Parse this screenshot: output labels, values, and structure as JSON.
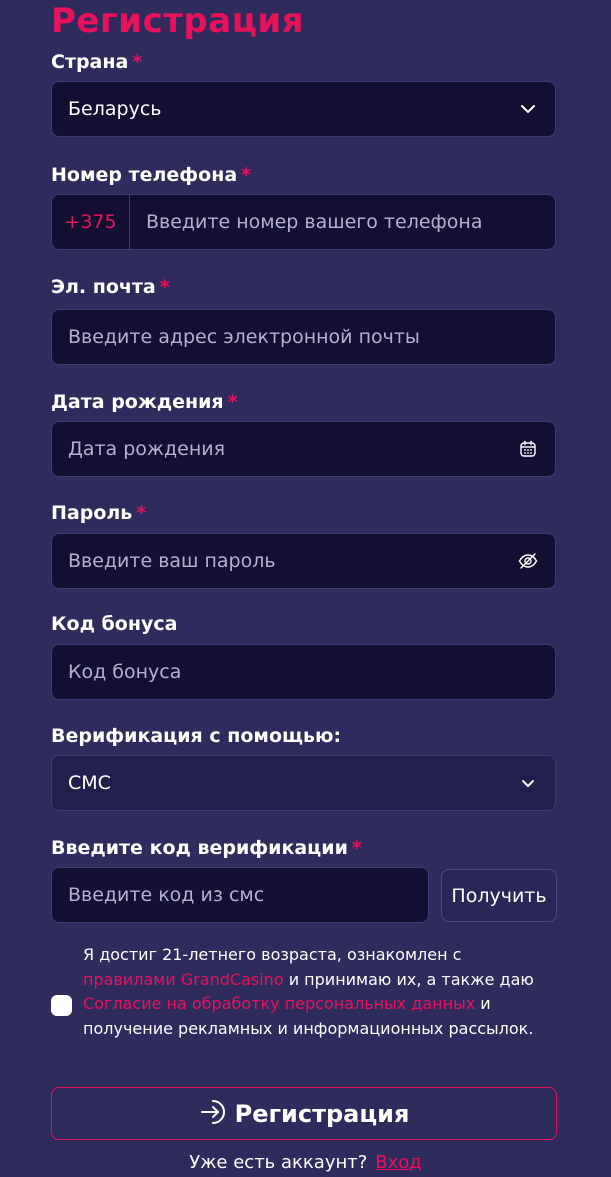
{
  "form": {
    "title": "Регистрация",
    "required_mark": "*",
    "country": {
      "label": "Страна",
      "value": "Беларусь"
    },
    "phone": {
      "label": "Номер телефона",
      "prefix": "+375",
      "placeholder": "Введите номер вашего телефона"
    },
    "email": {
      "label": "Эл. почта",
      "placeholder": "Введите адрес электронной почты"
    },
    "birthdate": {
      "label": "Дата рождения",
      "placeholder": "Дата рождения"
    },
    "password": {
      "label": "Пароль",
      "placeholder": "Введите ваш пароль"
    },
    "bonus": {
      "label": "Код бонуса",
      "placeholder": "Код бонуса"
    },
    "verification_method": {
      "label": "Верификация с помощью:",
      "value": "СМС"
    },
    "verification_code": {
      "label": "Введите код верификации",
      "placeholder": "Введите код из смс",
      "get_button": "Получить"
    },
    "consent": {
      "text_1": "Я достиг 21-летнего возраста, ознакомлен с",
      "link_rules": "правилами GrandCasino",
      "text_2": " и принимаю их, а также даю ",
      "link_consent": "Согласие на обработку персональных данных",
      "text_3": " и получение рекламных и информационных рассылок."
    },
    "submit_label": "Регистрация",
    "login_prompt": "Уже есть аккаунт?",
    "login_link": "Вход"
  },
  "colors": {
    "background": "#2f2b5c",
    "field": "#130f33",
    "accent": "#e8115c",
    "placeholder": "#b4b1cf"
  },
  "icons": {
    "country_dropdown": "chevron-down-icon",
    "birthdate": "calendar-icon",
    "password": "eye-off-icon",
    "verification_dropdown": "chevron-down-icon",
    "submit": "login-arrow-icon"
  }
}
